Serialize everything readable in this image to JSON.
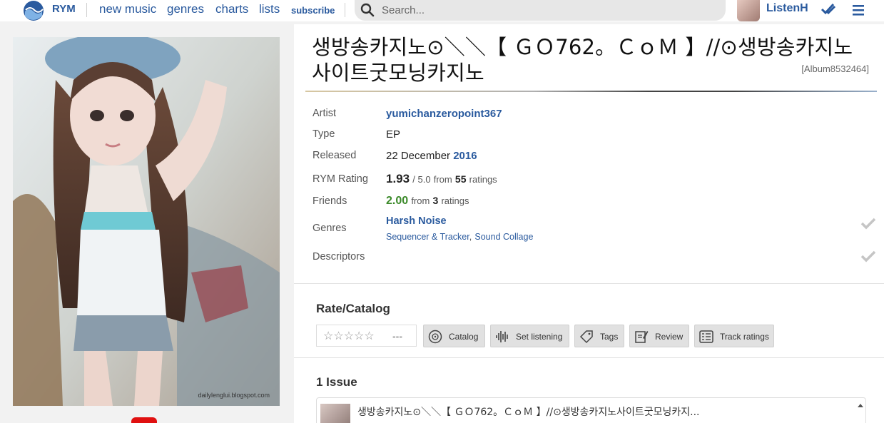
{
  "header": {
    "brand": "RYM",
    "nav": [
      "new music",
      "genres",
      "charts",
      "lists"
    ],
    "subscribe": "subscribe",
    "search_placeholder": "Search...",
    "username": "ListenH"
  },
  "cover": {
    "caption": "dailylenglui.blogspot.com"
  },
  "album": {
    "title": "생방송카지노⊙＼＼【 ＧＯ762。ＣｏＭ 】//⊙생방송카지노사이트굿모닝카지노",
    "id": "[Album8532464]"
  },
  "info": {
    "artist_label": "Artist",
    "artist": "yumichanzeropoint367",
    "type_label": "Type",
    "type": "EP",
    "released_label": "Released",
    "released_day": "22 December",
    "released_year": "2016",
    "rating_label": "RYM Rating",
    "rating": "1.93",
    "rating_max": "/ 5.0",
    "rating_from": "from",
    "rating_count": "55",
    "rating_suffix": "ratings",
    "friends_label": "Friends",
    "friends_rating": "2.00",
    "friends_from": "from",
    "friends_count": "3",
    "friends_suffix": "ratings",
    "genres_label": "Genres",
    "genre_primary": "Harsh Noise",
    "genre_secondary_1": "Sequencer & Tracker",
    "genre_sep": ",",
    "genre_secondary_2": "Sound Collage",
    "descriptors_label": "Descriptors"
  },
  "rate": {
    "title": "Rate/Catalog",
    "stars": "☆☆☆☆☆",
    "rating_placeholder": "---",
    "buttons": {
      "catalog": "Catalog",
      "set_listening": "Set listening",
      "tags": "Tags",
      "review": "Review",
      "track_ratings": "Track ratings"
    }
  },
  "issues": {
    "title": "1 Issue",
    "item_title": "생방송카지노⊙＼＼【 ＧＯ762。ＣｏＭ 】//⊙생방송카지노사이트굿모닝카지..."
  },
  "colors": {
    "link": "#2a5a9e",
    "friends_score": "#3c8a2a",
    "youtube": "#e01010"
  }
}
